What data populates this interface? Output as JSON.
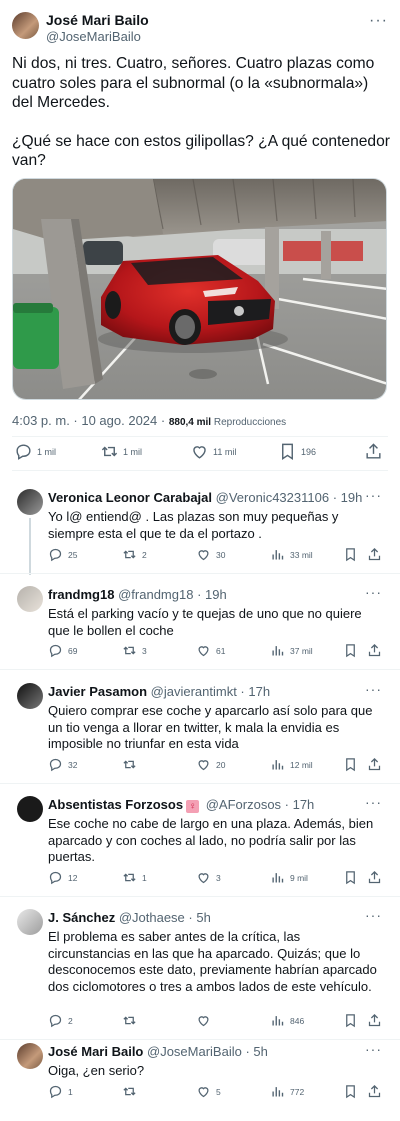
{
  "main": {
    "name": "José Mari Bailo",
    "handle": "@JoseMariBailo",
    "more": "···",
    "text1": "Ni dos, ni tres. Cuatro, señores. Cuatro plazas como cuatro soles para el subnormal (o la «subnormala») del Mercedes.",
    "text2": "¿Qué se hace con estos gilipollas? ¿A qué contenedor van?",
    "timestamp": "4:03 p. m. · 10 ago. 2024 · ",
    "views_num": "880,4 mil",
    "views_label": " Reproducciones",
    "actions": {
      "replies": "1 mil",
      "reposts": "1 mil",
      "likes": "11 mil",
      "bookmarks": "196"
    }
  },
  "replies": [
    {
      "name": "Veronica Leonor Carabajal",
      "handle": "@Veronic43231106",
      "time": " · 19h",
      "text": "Yo l@ entiend@ . Las plazas son muy pequeñas y siempre esta el que te da el portazo .",
      "replies": "25",
      "reposts": "2",
      "likes": "30",
      "views": "33 mil"
    },
    {
      "name": "frandmg18",
      "handle": "@frandmg18",
      "time": " · 19h",
      "text": "Está el parking vacío y te quejas de uno que no quiere que le bollen el coche",
      "replies": "69",
      "reposts": "3",
      "likes": "61",
      "views": "37 mil"
    },
    {
      "name": "Javier Pasamon",
      "handle": "@javierantimkt",
      "time": " · 17h",
      "text": "Quiero comprar ese coche y aparcarlo así solo para que un tio venga a llorar en twitter, k mala la envidia es imposible no triunfar en esta vida",
      "replies": "32",
      "reposts": "",
      "likes": "20",
      "views": "12 mil"
    },
    {
      "name": "Absentistas Forzosos",
      "badge": "♀",
      "handle": "@AForzosos",
      "time": " · 17h",
      "text": "Ese coche no cabe de largo en una plaza. Además, bien aparcado y con coches al lado, no podría salir por las puertas.",
      "replies": "12",
      "reposts": "1",
      "likes": "3",
      "views": "9 mil"
    },
    {
      "name": "J. Sánchez",
      "handle": "@Jothaese",
      "time": " · 5h",
      "text": "El problema es saber antes de la crítica, las circunstancias en las que ha aparcado. Quizás; que lo desconocemos este dato, previamente habrían aparcado dos ciclomotores o tres a ambos lados de este vehículo.",
      "replies": "2",
      "reposts": "",
      "likes": "",
      "views": "846"
    },
    {
      "name": "José Mari Bailo",
      "handle": "@JoseMariBailo",
      "time": " · 5h",
      "text": "Oiga, ¿en serio?",
      "replies": "1",
      "reposts": "",
      "likes": "5",
      "views": "772"
    }
  ]
}
